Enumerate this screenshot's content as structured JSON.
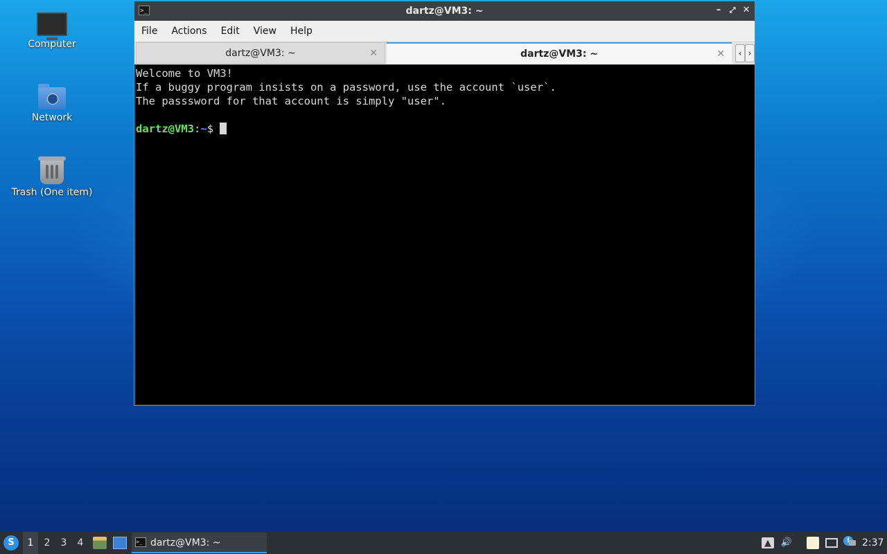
{
  "desktop": {
    "icons": [
      {
        "label": "Computer",
        "icon": "computer-icon"
      },
      {
        "label": "Network",
        "icon": "network-folder-icon"
      },
      {
        "label": "Trash (One item)",
        "icon": "trash-icon"
      }
    ]
  },
  "window": {
    "title": "dartz@VM3: ~",
    "controls": {
      "minimize": "–",
      "maximize": "⤢",
      "close": "✕"
    },
    "menu": [
      "File",
      "Actions",
      "Edit",
      "View",
      "Help"
    ],
    "tabs": [
      {
        "label": "dartz@VM3: ~",
        "active": false,
        "close": "✕"
      },
      {
        "label": "dartz@VM3: ~",
        "active": true,
        "close": "✕"
      }
    ],
    "tab_nav": {
      "prev": "‹",
      "next": "›"
    },
    "terminal": {
      "lines": [
        "Welcome to VM3!",
        "If a buggy program insists on a password, use the account `user`.",
        "The passsword for that account is simply \"user\"."
      ],
      "prompt_user_host": "dartz@VM3",
      "prompt_sep": ":",
      "prompt_path": "~",
      "prompt_symbol": "$ "
    }
  },
  "taskbar": {
    "workspaces": [
      "1",
      "2",
      "3",
      "4"
    ],
    "active_workspace": "1",
    "task_label": "dartz@VM3: ~",
    "clock": "2:37"
  },
  "colors": {
    "accent": "#3a9ae8",
    "prompt_user": "#5fe65f",
    "prompt_path": "#6a7cff",
    "terminal_bg": "#000000"
  }
}
